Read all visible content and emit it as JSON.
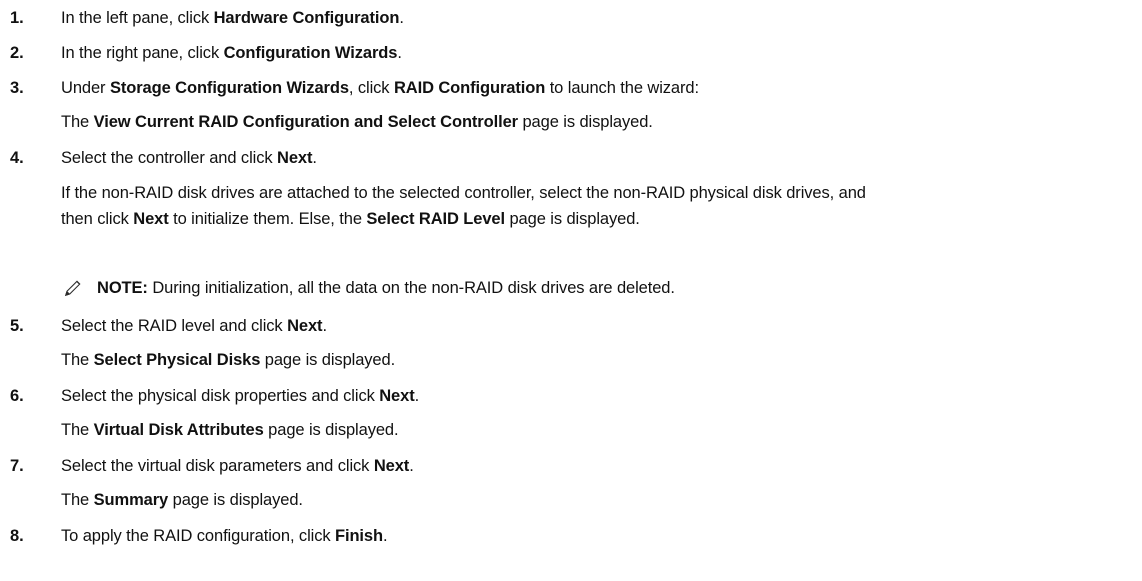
{
  "steps": [
    {
      "num": "1.",
      "parts": [
        {
          "t": "In the left pane, click "
        },
        {
          "b": "Hardware Configuration"
        },
        {
          "t": "."
        }
      ]
    },
    {
      "num": "2.",
      "parts": [
        {
          "t": "In the right pane, click "
        },
        {
          "b": "Configuration Wizards"
        },
        {
          "t": "."
        }
      ]
    },
    {
      "num": "3.",
      "parts": [
        {
          "t": "Under "
        },
        {
          "b": "Storage Configuration Wizards"
        },
        {
          "t": ", click "
        },
        {
          "b": "RAID Configuration"
        },
        {
          "t": " to launch the wizard:"
        }
      ],
      "sub": [
        [
          {
            "t": "The "
          },
          {
            "b": "View Current RAID Configuration and Select Controller"
          },
          {
            "t": " page is displayed."
          }
        ]
      ]
    },
    {
      "num": "4.",
      "parts": [
        {
          "t": "Select the controller and click "
        },
        {
          "b": "Next"
        },
        {
          "t": "."
        }
      ],
      "sub": [
        [
          {
            "t": "If the non-RAID disk drives are attached to the selected controller, select the non-RAID physical disk drives, and"
          }
        ],
        [
          {
            "t": "then click "
          },
          {
            "b": "Next"
          },
          {
            "t": " to initialize them. Else, the "
          },
          {
            "b": "Select RAID Level"
          },
          {
            "t": " page is displayed."
          }
        ]
      ]
    },
    {
      "num": "5.",
      "parts": [
        {
          "t": "Select the RAID level and click "
        },
        {
          "b": "Next"
        },
        {
          "t": "."
        }
      ],
      "sub": [
        [
          {
            "t": "The "
          },
          {
            "b": "Select Physical Disks"
          },
          {
            "t": " page is displayed."
          }
        ]
      ]
    },
    {
      "num": "6.",
      "parts": [
        {
          "t": "Select the physical disk properties and click "
        },
        {
          "b": "Next"
        },
        {
          "t": "."
        }
      ],
      "sub": [
        [
          {
            "t": "The "
          },
          {
            "b": "Virtual Disk Attributes"
          },
          {
            "t": " page is displayed."
          }
        ]
      ]
    },
    {
      "num": "7.",
      "parts": [
        {
          "t": "Select the virtual disk parameters and click "
        },
        {
          "b": "Next"
        },
        {
          "t": "."
        }
      ],
      "sub": [
        [
          {
            "t": "The "
          },
          {
            "b": "Summary"
          },
          {
            "t": " page is displayed."
          }
        ]
      ]
    },
    {
      "num": "8.",
      "parts": [
        {
          "t": "To apply the RAID configuration, click "
        },
        {
          "b": "Finish"
        },
        {
          "t": "."
        }
      ]
    }
  ],
  "note": {
    "icon": "note-pencil-icon",
    "label": "NOTE:",
    "text": " During initialization, all the data on the non-RAID disk drives are deleted."
  }
}
